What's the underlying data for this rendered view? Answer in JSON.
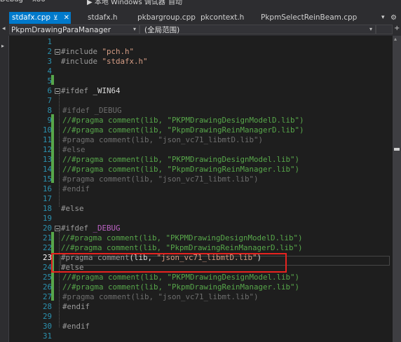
{
  "toolbar": {
    "config": "Debug",
    "platform": "x86",
    "run_label": "▶ 本地 Windows 调试器",
    "mode": "自动"
  },
  "tabs": [
    {
      "label": "stdafx.cpp",
      "active": true
    },
    {
      "label": "stdafx.h",
      "active": false
    },
    {
      "label": "pkbargroup.cpp",
      "active": false
    },
    {
      "label": "pkcontext.h",
      "active": false
    },
    {
      "label": "PkpmSelectReinBeam.cpp",
      "active": false
    }
  ],
  "navbar": {
    "class_scope": "PkpmDrawingParaManager",
    "member_scope": "(全局范围)"
  },
  "editor": {
    "current_line": 23,
    "lines": [
      {
        "n": 1,
        "t": []
      },
      {
        "n": 2,
        "t": [
          [
            "pre",
            "#include "
          ],
          [
            "str",
            "\"pch.h\""
          ]
        ]
      },
      {
        "n": 3,
        "t": [
          [
            "pre",
            "#include "
          ],
          [
            "str",
            "\"stdafx.h\""
          ]
        ]
      },
      {
        "n": 4,
        "t": []
      },
      {
        "n": 5,
        "t": []
      },
      {
        "n": 6,
        "t": [
          [
            "pre",
            "#ifdef "
          ],
          [
            "txt",
            "_WIN64"
          ]
        ]
      },
      {
        "n": 7,
        "t": []
      },
      {
        "n": 8,
        "t": [
          [
            "dis",
            "#ifdef _DEBUG"
          ]
        ]
      },
      {
        "n": 9,
        "t": [
          [
            "com",
            "//#pragma comment(lib, \"PKPMDrawingDesignModelD.lib\")"
          ]
        ]
      },
      {
        "n": 10,
        "t": [
          [
            "com",
            "//#pragma comment(lib, \"PkpmDrawingReinManagerD.lib\")"
          ]
        ]
      },
      {
        "n": 11,
        "t": [
          [
            "dis",
            "#pragma comment(lib, \"json_vc71_libmtD.lib\")"
          ]
        ]
      },
      {
        "n": 12,
        "t": [
          [
            "dis",
            "#else"
          ]
        ]
      },
      {
        "n": 13,
        "t": [
          [
            "com",
            "//#pragma comment(lib, \"PKPMDrawingDesignModel.lib\")"
          ]
        ]
      },
      {
        "n": 14,
        "t": [
          [
            "com",
            "//#pragma comment(lib, \"PkpmDrawingReinManager.lib\")"
          ]
        ]
      },
      {
        "n": 15,
        "t": [
          [
            "dis",
            "#pragma comment(lib, \"json_vc71_libmt.lib\")"
          ]
        ]
      },
      {
        "n": 16,
        "t": [
          [
            "dis",
            "#endif"
          ]
        ]
      },
      {
        "n": 17,
        "t": []
      },
      {
        "n": 18,
        "t": [
          [
            "pre",
            "#else"
          ]
        ]
      },
      {
        "n": 19,
        "t": []
      },
      {
        "n": 20,
        "t": [
          [
            "pre",
            "#ifdef "
          ],
          [
            "mac",
            "_DEBUG"
          ]
        ]
      },
      {
        "n": 21,
        "t": [
          [
            "com",
            "//#pragma comment(lib, \"PKPMDrawingDesignModelD.lib\")"
          ]
        ]
      },
      {
        "n": 22,
        "t": [
          [
            "com",
            "//#pragma comment(lib, \"PkpmDrawingReinManagerD.lib\")"
          ]
        ]
      },
      {
        "n": 23,
        "t": [
          [
            "pre",
            "#pragma comment"
          ],
          [
            "txt",
            "(lib, "
          ],
          [
            "str",
            "\"json_vc71_libmtD.lib\""
          ],
          [
            "txt",
            ")"
          ]
        ]
      },
      {
        "n": 24,
        "t": [
          [
            "pre",
            "#else"
          ]
        ]
      },
      {
        "n": 25,
        "t": [
          [
            "com",
            "//#pragma comment(lib, \"PKPMDrawingDesignModel.lib\")"
          ]
        ]
      },
      {
        "n": 26,
        "t": [
          [
            "com",
            "//#pragma comment(lib, \"PkpmDrawingReinManager.lib\")"
          ]
        ]
      },
      {
        "n": 27,
        "t": [
          [
            "dis",
            "#pragma comment(lib, \"json_vc71_libmt.lib\")"
          ]
        ]
      },
      {
        "n": 28,
        "t": [
          [
            "pre",
            "#endif"
          ]
        ]
      },
      {
        "n": 29,
        "t": []
      },
      {
        "n": 30,
        "t": [
          [
            "pre",
            "#endif"
          ]
        ]
      },
      {
        "n": 31,
        "t": []
      }
    ]
  },
  "colors": {
    "accent": "#007acc",
    "highlight_box": "#e8231f",
    "change_bar": "#57a64a"
  }
}
